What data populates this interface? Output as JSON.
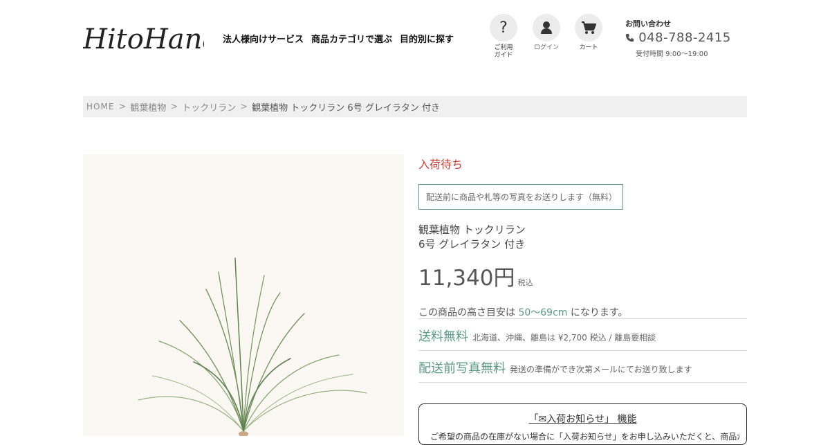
{
  "header": {
    "logo_text": "HitoHana",
    "nav": [
      {
        "label": "法人様向けサービス"
      },
      {
        "label": "商品カテゴリで選ぶ"
      },
      {
        "label": "目的別に探す"
      }
    ],
    "icons": [
      {
        "name": "help",
        "label": "ご利用\nガイド",
        "icon": "question-icon"
      },
      {
        "name": "login",
        "label": "ログイン",
        "icon": "user-icon"
      },
      {
        "name": "cart",
        "label": "カート",
        "icon": "cart-icon"
      }
    ],
    "contact": {
      "title": "お問い合わせ",
      "phone": "048-788-2415",
      "hours": "受付時間 9:00〜19:00"
    }
  },
  "breadcrumb": {
    "items": [
      "HOME",
      "観葉植物",
      "トックリラン"
    ],
    "current": "観葉植物 トックリラン 6号 グレイラタン 付き"
  },
  "product": {
    "stock_status": "入荷待ち",
    "photo_note": "配送前に商品や札等の写真をお送りします（無料）",
    "name_line1": "観葉植物 トックリラン",
    "name_line2": "6号 グレイラタン 付き",
    "price": "11,340円",
    "tax_label": "税込",
    "height_prefix": "この商品の高さ目安は",
    "height_value": "50〜69cm",
    "height_suffix": "になります。",
    "shipping": {
      "title": "送料無料",
      "detail": "北海道、沖縄、離島は ¥2,700 税込 / 離島要相談"
    },
    "photo_service": {
      "title": "配送前写真無料",
      "detail": "発送の準備ができ次第メールにてお送り致します"
    },
    "notify": {
      "title": "「✉入荷お知らせ」 機能",
      "body": "ご希望の商品の在庫がない場合に「入荷お知らせ」をお申し込みいただくと、商品が入荷"
    }
  },
  "colors": {
    "accent": "#5a9a86",
    "stock": "#d23c32",
    "breadcrumb_bg": "#f0f0f0"
  }
}
